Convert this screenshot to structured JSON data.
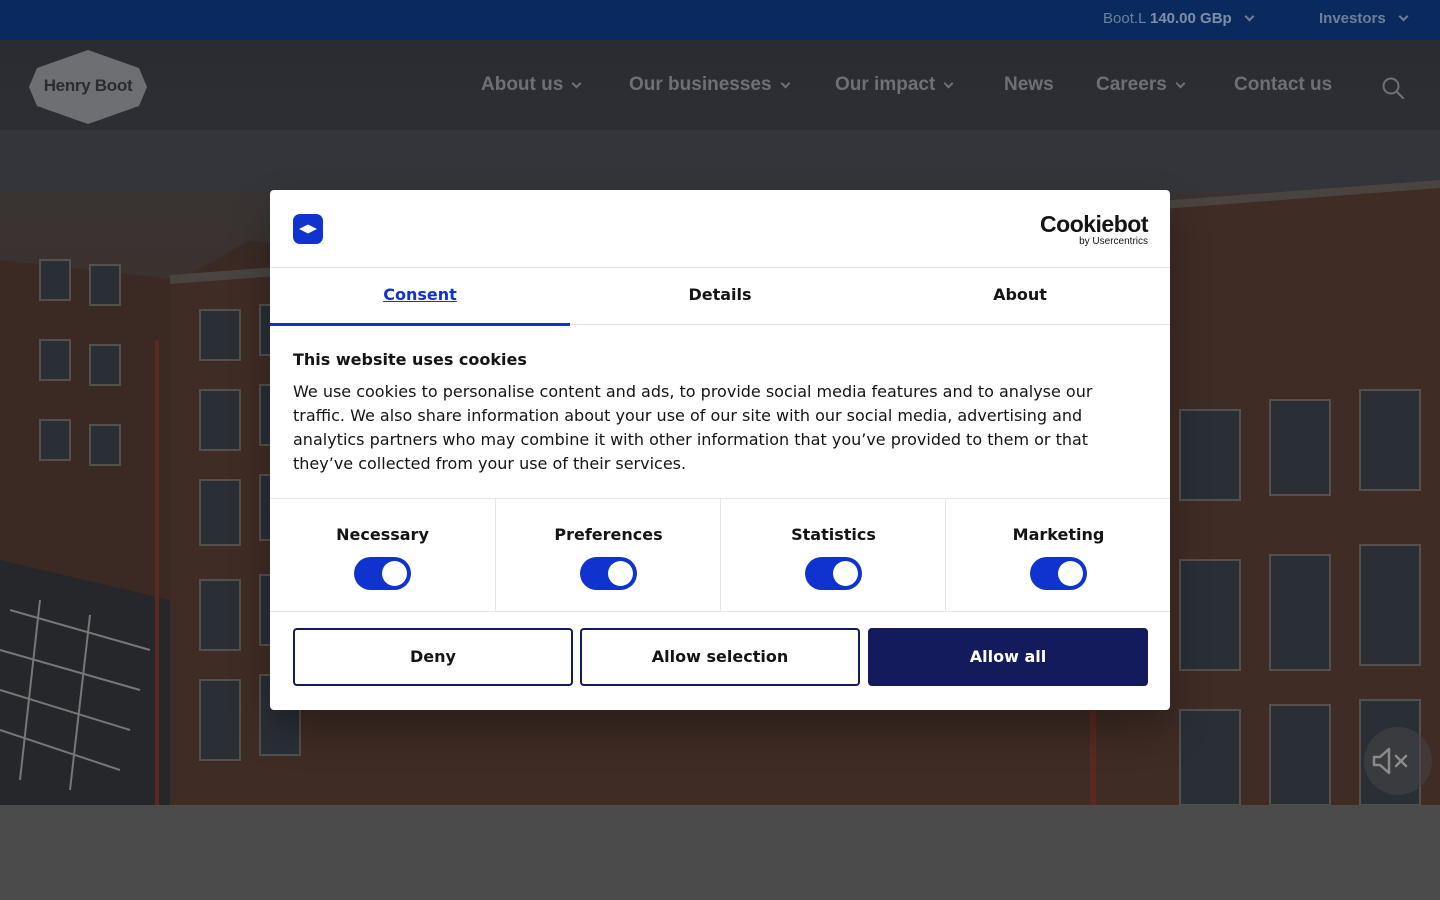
{
  "topbar": {
    "ticker_symbol": "Boot.L",
    "ticker_price": "140.00 GBp",
    "investors_label": "Investors"
  },
  "header": {
    "logo_text": "Henry Boot",
    "nav": [
      {
        "label": "About us"
      },
      {
        "label": "Our businesses"
      },
      {
        "label": "Our impact"
      },
      {
        "label": "News"
      },
      {
        "label": "Careers"
      },
      {
        "label": "Contact us"
      }
    ]
  },
  "cookie_dialog": {
    "brand_name": "Cookiebot",
    "brand_sub": "by Usercentrics",
    "tabs": [
      {
        "label": "Consent",
        "active": true
      },
      {
        "label": "Details",
        "active": false
      },
      {
        "label": "About",
        "active": false
      }
    ],
    "title": "This website uses cookies",
    "body": "We use cookies to personalise content and ads, to provide social media features and to analyse our traffic. We also share information about your use of our site with our social media, advertising and analytics partners who may combine it with other information that you’ve provided to them or that they’ve collected from your use of their services.",
    "categories": [
      {
        "label": "Necessary",
        "enabled": true
      },
      {
        "label": "Preferences",
        "enabled": true
      },
      {
        "label": "Statistics",
        "enabled": true
      },
      {
        "label": "Marketing",
        "enabled": true
      }
    ],
    "buttons": {
      "deny": "Deny",
      "allow_selection": "Allow selection",
      "allow_all": "Allow all"
    }
  },
  "colors": {
    "topbar_bg": "#0a2a5e",
    "accent": "#1032cf",
    "primary_button": "#141b5c"
  },
  "icons": {
    "search": "search-icon",
    "mute": "volume-mute-icon",
    "chevron": "chevron-down-icon"
  }
}
